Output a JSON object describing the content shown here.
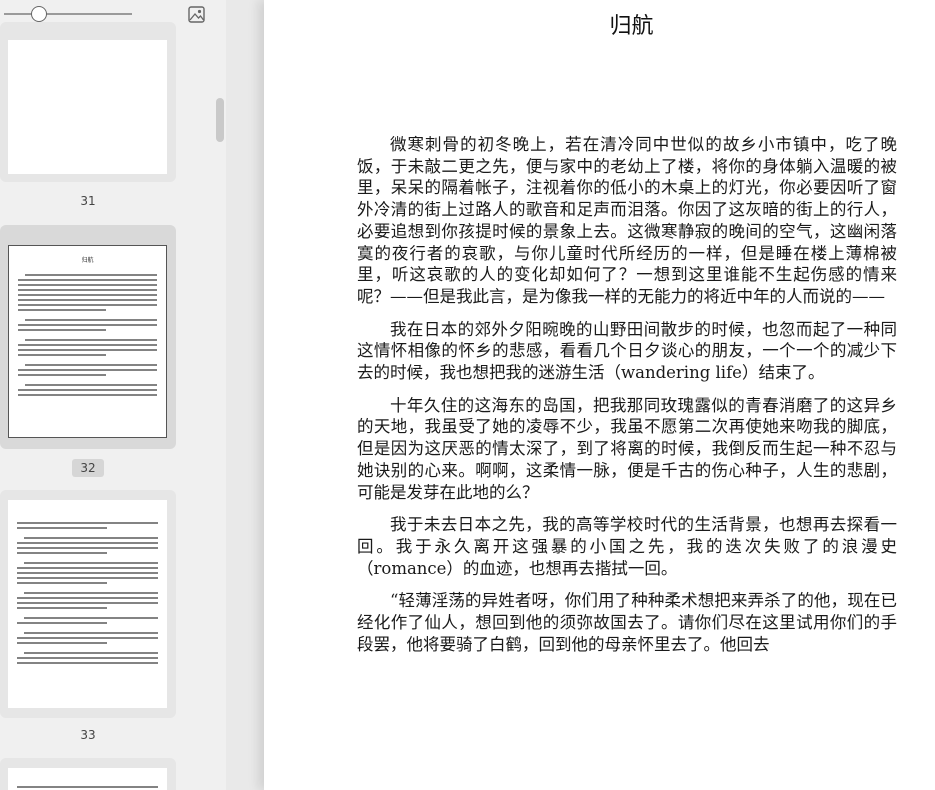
{
  "sidebar": {
    "zoom_slider": {
      "value": 0.23
    },
    "image_icon": "image-icon",
    "thumbnails": [
      {
        "label": "31",
        "selected": false
      },
      {
        "label": "32",
        "selected": true,
        "title": "归航"
      },
      {
        "label": "33",
        "selected": false
      }
    ]
  },
  "document": {
    "title": "归航",
    "paragraphs": [
      "微寒刺骨的初冬晚上，若在清冷同中世似的故乡小市镇中，吃了晚饭，于未敲二更之先，便与家中的老幼上了楼，将你的身体躺入温暖的被里，呆呆的隔着帐子，注视着你的低小的木桌上的灯光，你必要因听了窗外冷清的街上过路人的歌音和足声而泪落。你因了这灰暗的街上的行人，必要追想到你孩提时候的景象上去。这微寒静寂的晚间的空气，这幽闲落寞的夜行者的哀歌，与你儿童时代所经历的一样，但是睡在楼上薄棉被里，听这哀歌的人的变化却如何了？一想到这里谁能不生起伤感的情来呢？——但是我此言，是为像我一样的无能力的将近中年的人而说的——",
      "我在日本的郊外夕阳晼晚的山野田间散步的时候，也忽而起了一种同这情怀相像的怀乡的悲感，看看几个日夕谈心的朋友，一个一个的减少下去的时候，我也想把我的迷游生活（wandering life）结束了。",
      "十年久住的这海东的岛国，把我那同玫瑰露似的青春消磨了的这异乡的天地，我虽受了她的凌辱不少，我虽不愿第二次再使她来吻我的脚底，但是因为这厌恶的情太深了，到了将离的时候，我倒反而生起一种不忍与她诀别的心来。啊啊，这柔情一脉，便是千古的伤心种子，人生的悲剧，可能是发芽在此地的么？",
      "我于未去日本之先，我的高等学校时代的生活背景，也想再去探看一回。我于永久离开这强暴的小国之先，我的迭次失败了的浪漫史（romance）的血迹，也想再去揩拭一回。",
      "“轻薄淫荡的异姓者呀，你们用了种种柔术想把来弄杀了的他，现在已经化作了仙人，想回到他的须弥故国去了。请你们尽在这里试用你们的手段罢，他将要骑了白鹤，回到他的母亲怀里去了。他回去"
    ]
  }
}
